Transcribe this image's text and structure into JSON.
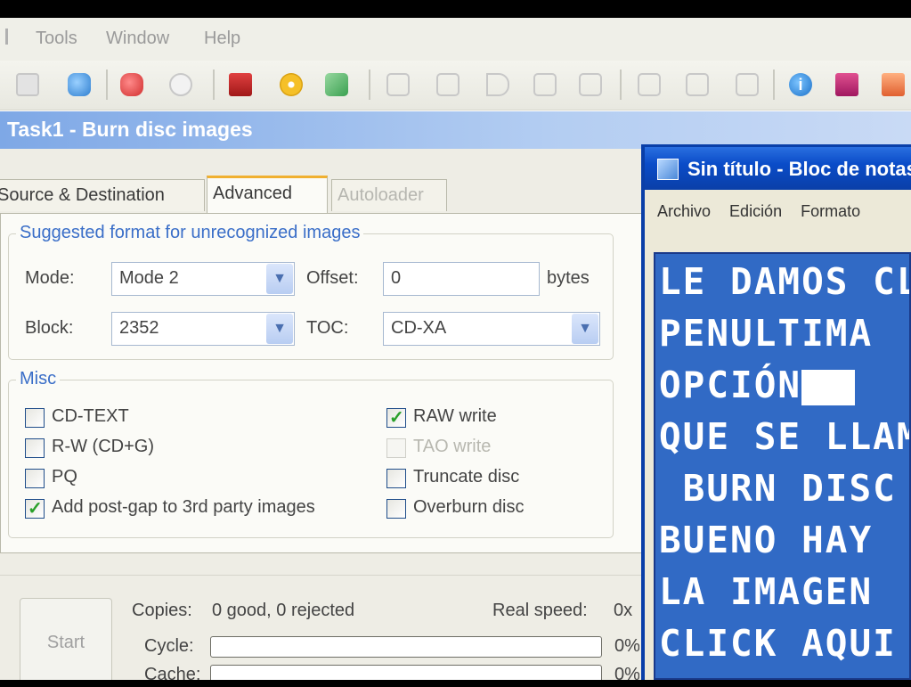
{
  "menu": {
    "partial_left": "",
    "tools": "Tools",
    "window": "Window",
    "help": "Help"
  },
  "toolbar": {
    "icons": [
      "print-icon",
      "save-disc-icon",
      "close-x-icon",
      "search-icon",
      "film-icon",
      "disc-icon",
      "copy-icon",
      "rewind-icon",
      "fast-forward-icon",
      "play-icon",
      "stop-icon",
      "eject-icon",
      "music-icon",
      "document-icon",
      "new-window-icon",
      "info-icon",
      "book-icon",
      "home-icon"
    ]
  },
  "task_title": "Task1 - Burn disc images",
  "tabs": [
    {
      "label": "Source & Destination",
      "state": "normal"
    },
    {
      "label": "Advanced",
      "state": "active"
    },
    {
      "label": "Autoloader",
      "state": "disabled"
    }
  ],
  "format_group": {
    "title": "Suggested format for unrecognized images",
    "mode_label": "Mode:",
    "mode_value": "Mode 2",
    "offset_label": "Offset:",
    "offset_value": "0",
    "bytes_label": "bytes",
    "block_label": "Block:",
    "block_value": "2352",
    "toc_label": "TOC:",
    "toc_value": "CD-XA"
  },
  "misc_group": {
    "title": "Misc",
    "checkboxes": [
      {
        "label": "CD-TEXT",
        "checked": false,
        "enabled": true
      },
      {
        "label": "R-W (CD+G)",
        "checked": false,
        "enabled": true
      },
      {
        "label": "PQ",
        "checked": false,
        "enabled": true
      },
      {
        "label": "Add post-gap to 3rd party images",
        "checked": true,
        "enabled": true
      },
      {
        "label": "RAW write",
        "checked": true,
        "enabled": true
      },
      {
        "label": "TAO write",
        "checked": false,
        "enabled": false
      },
      {
        "label": "Truncate disc",
        "checked": false,
        "enabled": true
      },
      {
        "label": "Overburn disc",
        "checked": false,
        "enabled": true
      }
    ]
  },
  "progress": {
    "start_label": "Start",
    "copies_label": "Copies:",
    "copies_value": "0 good, 0 rejected",
    "real_speed_label": "Real speed:",
    "real_speed_value": "0x",
    "cycle_label": "Cycle:",
    "cycle_percent": "0%",
    "cycle_fill": 0,
    "cache_label": "Cache:",
    "cache_percent": "0%",
    "cache_fill": 0
  },
  "notepad": {
    "title": "Sin título - Bloc de notas",
    "menu": [
      "Archivo",
      "Edición",
      "Formato"
    ],
    "lines": [
      "LE DAMOS CLICK",
      "PENULTIMA",
      "OPCIÓN",
      "QUE SE LLAMA",
      " BURN DISC",
      "BUENO HAY",
      "LA IMAGEN",
      "CLICK AQUI"
    ]
  }
}
